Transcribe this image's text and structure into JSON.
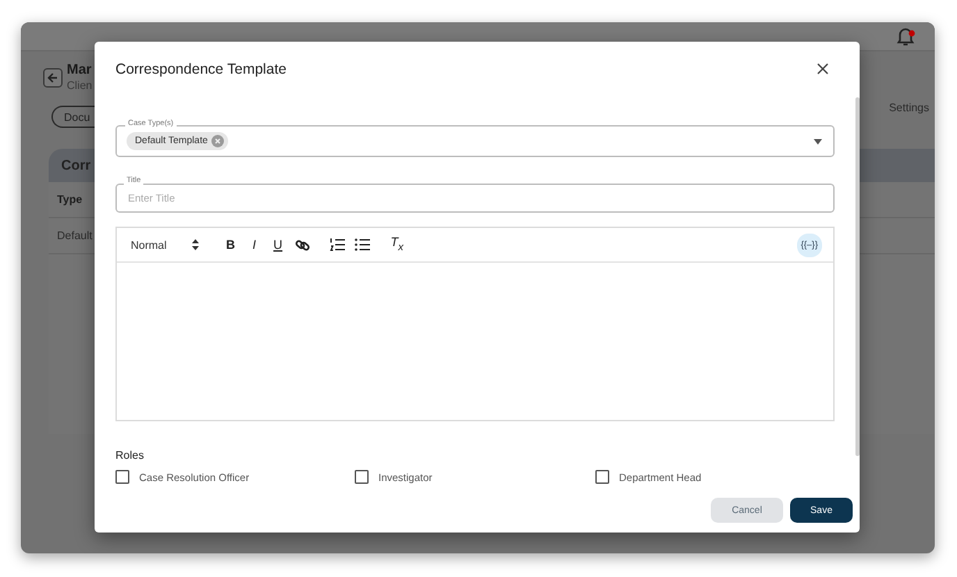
{
  "background": {
    "page_title": "Mar",
    "page_subtitle": "Clien",
    "tab_button": "Docu",
    "card_title": "Corr",
    "column_header": "Type",
    "cell": "Default",
    "nav_link": "Settings"
  },
  "modal": {
    "title": "Correspondence Template",
    "case_types": {
      "label": "Case Type(s)",
      "chips": [
        {
          "label": "Default Template"
        }
      ]
    },
    "title_field": {
      "label": "Title",
      "placeholder": "Enter Title"
    },
    "editor": {
      "format": "Normal",
      "toolbar": [
        {
          "kind": "bold",
          "label": "B"
        },
        {
          "kind": "italic",
          "label": "I"
        },
        {
          "kind": "underline",
          "label": "U"
        },
        {
          "kind": "link"
        },
        {
          "kind": "ordered_list"
        },
        {
          "kind": "bullet_list"
        },
        {
          "kind": "clean",
          "label": "T$_{x}$"
        }
      ],
      "variable_button": "{{–}}"
    },
    "roles": {
      "label": "Roles",
      "options": [
        {
          "label": "Case Resolution Officer",
          "checked": false
        },
        {
          "label": "Investigator",
          "checked": false
        },
        {
          "label": "Department Head",
          "checked": false
        }
      ]
    },
    "buttons": {
      "cancel": "Cancel",
      "save": "Save"
    }
  }
}
